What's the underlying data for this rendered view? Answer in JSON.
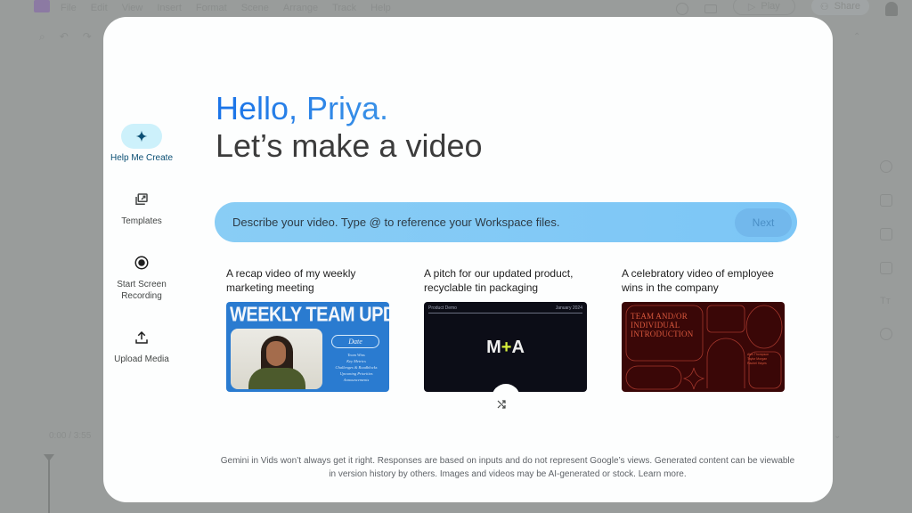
{
  "background_app": {
    "menu": [
      "File",
      "Edit",
      "View",
      "Insert",
      "Format",
      "Scene",
      "Arrange",
      "Track",
      "Help"
    ],
    "play_label": "Play",
    "share_label": "Share",
    "timecode": "0:00 / 3:55"
  },
  "sidebar": {
    "items": [
      {
        "label": "Help Me Create",
        "icon": "sparkle-icon",
        "active": true
      },
      {
        "label": "Templates",
        "icon": "templates-icon",
        "active": false
      },
      {
        "label": "Start Screen Recording",
        "icon": "record-icon",
        "active": false
      },
      {
        "label": "Upload Media",
        "icon": "upload-icon",
        "active": false
      }
    ]
  },
  "greeting": {
    "hello": "Hello, Priya.",
    "subtitle": "Let’s make a video"
  },
  "prompt": {
    "placeholder": "Describe your video. Type @ to reference your Workspace files.",
    "value": "",
    "next_label": "Next"
  },
  "suggestions": [
    {
      "title": "A recap video of my weekly marketing meeting",
      "thumbnail": {
        "heading": "WEEKLY TEAM UPDATES",
        "date_label": "Date",
        "lines": [
          "Team Wins",
          "Key Metrics",
          "Challenges & Roadblocks",
          "Upcoming Priorities",
          "Announcements"
        ]
      }
    },
    {
      "title": "A pitch for our updated product, recyclable tin packaging",
      "thumbnail": {
        "top_left": "Product Demo",
        "top_right": "January 2024",
        "logo_left": "M",
        "logo_plus": "+",
        "logo_right": "A"
      }
    },
    {
      "title": "A celebratory video of employee wins in the company",
      "thumbnail": {
        "heading_lines": [
          "TEAM AND/OR",
          "INDIVIDUAL",
          "INTRODUCTION"
        ],
        "names": [
          "Alex Thompson",
          "Taylor Morgan",
          "Rachel Hayes"
        ]
      }
    }
  ],
  "shuffle": {
    "icon": "shuffle-icon"
  },
  "disclaimer": {
    "text": "Gemini in Vids won’t always get it right. Responses are based on inputs and do not represent Google’s views. Generated content can be viewable in version history by others. Images and videos may be AI-generated or stock. ",
    "link": "Learn more."
  },
  "colors": {
    "accent": "#1a73e8",
    "prompt_bg": "#89cdf5",
    "active_nav_bg": "#cdf1fb",
    "overlay": "#999c9b"
  }
}
